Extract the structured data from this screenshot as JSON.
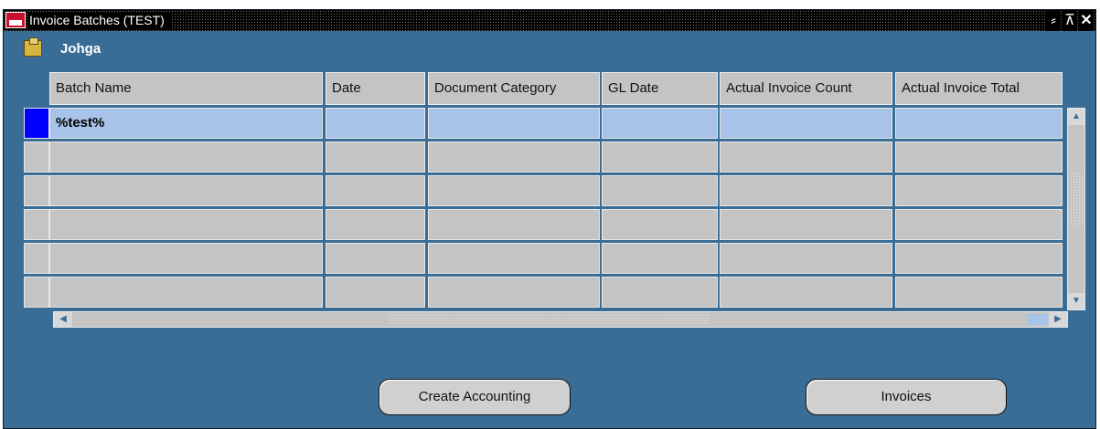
{
  "window": {
    "title": "Invoice Batches (TEST)",
    "min_glyph": "⸗",
    "max_glyph": "⊼",
    "close_glyph": "✕"
  },
  "folder": {
    "name": "Johga"
  },
  "table": {
    "columns": [
      "Batch Name",
      "Date",
      "Document Category",
      "GL Date",
      "Actual Invoice Count",
      "Actual Invoice Total"
    ],
    "rows": [
      [
        "%test%",
        "",
        "",
        "",
        "",
        ""
      ],
      [
        "",
        "",
        "",
        "",
        "",
        ""
      ],
      [
        "",
        "",
        "",
        "",
        "",
        ""
      ],
      [
        "",
        "",
        "",
        "",
        "",
        ""
      ],
      [
        "",
        "",
        "",
        "",
        "",
        ""
      ],
      [
        "",
        "",
        "",
        "",
        "",
        ""
      ]
    ],
    "current_row": 0
  },
  "buttons": {
    "create_accounting": "Create Accounting",
    "invoices": "Invoices"
  },
  "colors": {
    "background": "#3a6d95",
    "field": "#c4c4c4",
    "active_field": "#a7c3e8",
    "row_indicator": "#0000ff"
  },
  "icons": {
    "window_icon": "oracle-app-icon",
    "folder_icon": "folder-open-icon"
  }
}
